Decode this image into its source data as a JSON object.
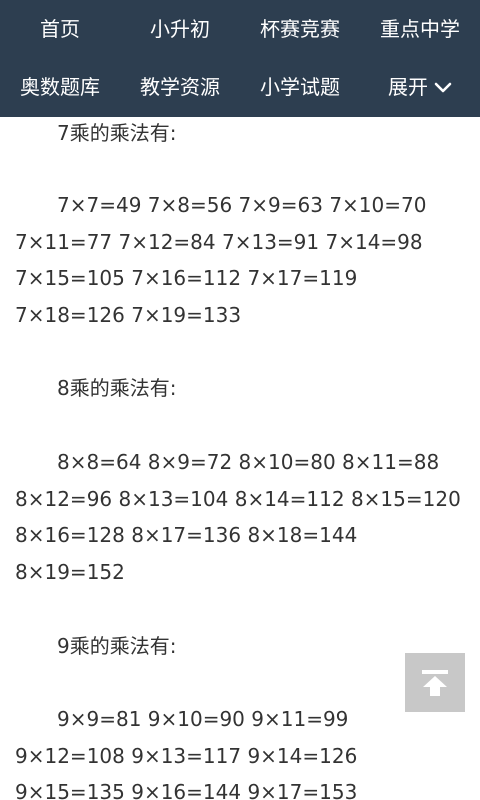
{
  "nav": {
    "row1": [
      "首页",
      "小升初",
      "杯赛竞赛",
      "重点中学"
    ],
    "row2": [
      "奥数题库",
      "教学资源",
      "小学试题",
      "展开"
    ],
    "expand_icon": "chevron-down-icon",
    "background": "#2d3e50"
  },
  "content": {
    "lines": [
      "7乘的乘法有:",
      "7×7=49 7×8=56 7×9=63 7×10=70",
      "7×11=77 7×12=84 7×13=91 7×14=98",
      "7×15=105 7×16=112 7×17=119",
      "7×18=126 7×19=133",
      "8乘的乘法有:",
      "8×8=64 8×9=72 8×10=80 8×11=88",
      "8×12=96 8×13=104 8×14=112 8×15=120",
      "8×16=128 8×17=136 8×18=144",
      "8×19=152",
      "9乘的乘法有:",
      "9×9=81 9×10=90 9×11=99",
      "9×12=108 9×13=117 9×14=126",
      "9×15=135 9×16=144 9×17=153"
    ]
  },
  "back_to_top": {
    "icon": "arrow-up-to-top-icon",
    "background": "#c8c8c8"
  }
}
